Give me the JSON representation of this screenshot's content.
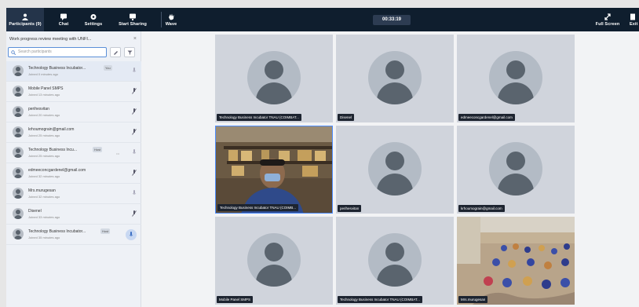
{
  "toolbar": {
    "left_buttons": [
      {
        "label": "Participants (9)",
        "icon": "participants-icon"
      },
      {
        "label": "Chat",
        "icon": "chat-icon"
      },
      {
        "label": "Settings",
        "icon": "settings-icon"
      },
      {
        "label": "Start Sharing",
        "icon": "share-screen-icon"
      },
      {
        "label": "Wave",
        "icon": "wave-hand-icon"
      }
    ],
    "timer": "00:33:19",
    "right_buttons": [
      {
        "label": "Full Screen",
        "icon": "fullscreen-icon"
      },
      {
        "label": "Exit",
        "icon": "exit-icon"
      }
    ]
  },
  "sidebar": {
    "meeting_title": "Work progress review meeting with UNFI...",
    "search_placeholder": "Search participants",
    "participants": [
      {
        "name": "Technology Business Incubator...",
        "time": "Joined 0 minutes ago",
        "badge": "You"
      },
      {
        "name": "Mobile Panel SMPS",
        "time": "Joined 13 minutes ago"
      },
      {
        "name": "perihesvitan",
        "time": "Joined 20 minutes ago"
      },
      {
        "name": "krhoumograin@gmail.com",
        "time": "Joined 25 minutes ago"
      },
      {
        "name": "Technology Business Incu...",
        "time": "Joined 25 minutes ago",
        "badge": "Host"
      },
      {
        "name": "edmeeconcgardenel@gmail.com",
        "time": "Joined 32 minutes ago"
      },
      {
        "name": "Mrs.murugesan",
        "time": "Joined 32 minutes ago"
      },
      {
        "name": "Disenel",
        "time": "Joined 33 minutes ago"
      },
      {
        "name": "Technology Business Incubator...",
        "time": "Joined 35 minutes ago",
        "badge": "Host"
      }
    ]
  },
  "tiles": [
    {
      "label": "Technology Business Incubator TNAU (COIMBAT..."
    },
    {
      "label": "Disenel"
    },
    {
      "label": "edmeeconcgardenel@gmail.com"
    },
    {
      "label": "Technology Business Incubator TNAU (COIMB..."
    },
    {
      "label": "perihesvitan"
    },
    {
      "label": "krhoumograin@gmail.com"
    },
    {
      "label": "Mobile Panel SMPS"
    },
    {
      "label": "Technology Business Incubator TNAU (COIMBAT..."
    },
    {
      "label": "Mrs.murugesan"
    }
  ],
  "colors": {
    "toolbar_bg": "#0f1e2e",
    "active_border": "#4d8dff",
    "avatar_bg": "#b3bbc5"
  }
}
